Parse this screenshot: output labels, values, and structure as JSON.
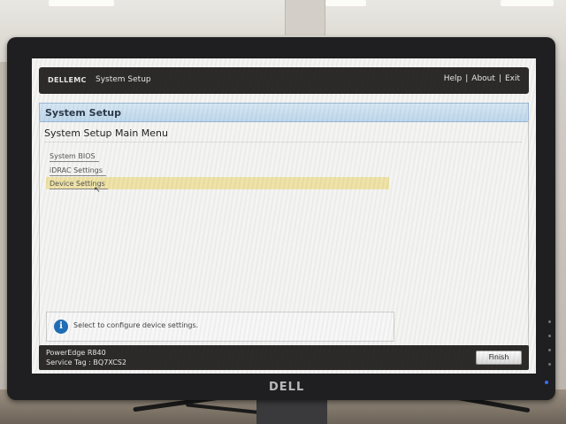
{
  "window": {
    "brand": "DELLEMC",
    "title": "System Setup",
    "links": [
      "Help",
      "About",
      "Exit"
    ],
    "separator": "|"
  },
  "section": {
    "title": "System Setup"
  },
  "menu": {
    "title": "System Setup Main Menu",
    "items": [
      {
        "label": "System BIOS",
        "selected": false
      },
      {
        "label": "iDRAC Settings",
        "selected": false
      },
      {
        "label": "Device Settings",
        "selected": true
      }
    ]
  },
  "help": {
    "icon": "info-icon",
    "text": "Select to configure device settings."
  },
  "footer": {
    "model": "PowerEdge R840",
    "service_tag": "Service Tag : BQ7XCS2",
    "finish_label": "Finish"
  },
  "bezel": {
    "logo": "DELL"
  },
  "colors": {
    "bar": "#2d2b29",
    "header_blue": "#bfd8ec",
    "highlight": "#efe3a8",
    "info_blue": "#1f6fb8"
  }
}
